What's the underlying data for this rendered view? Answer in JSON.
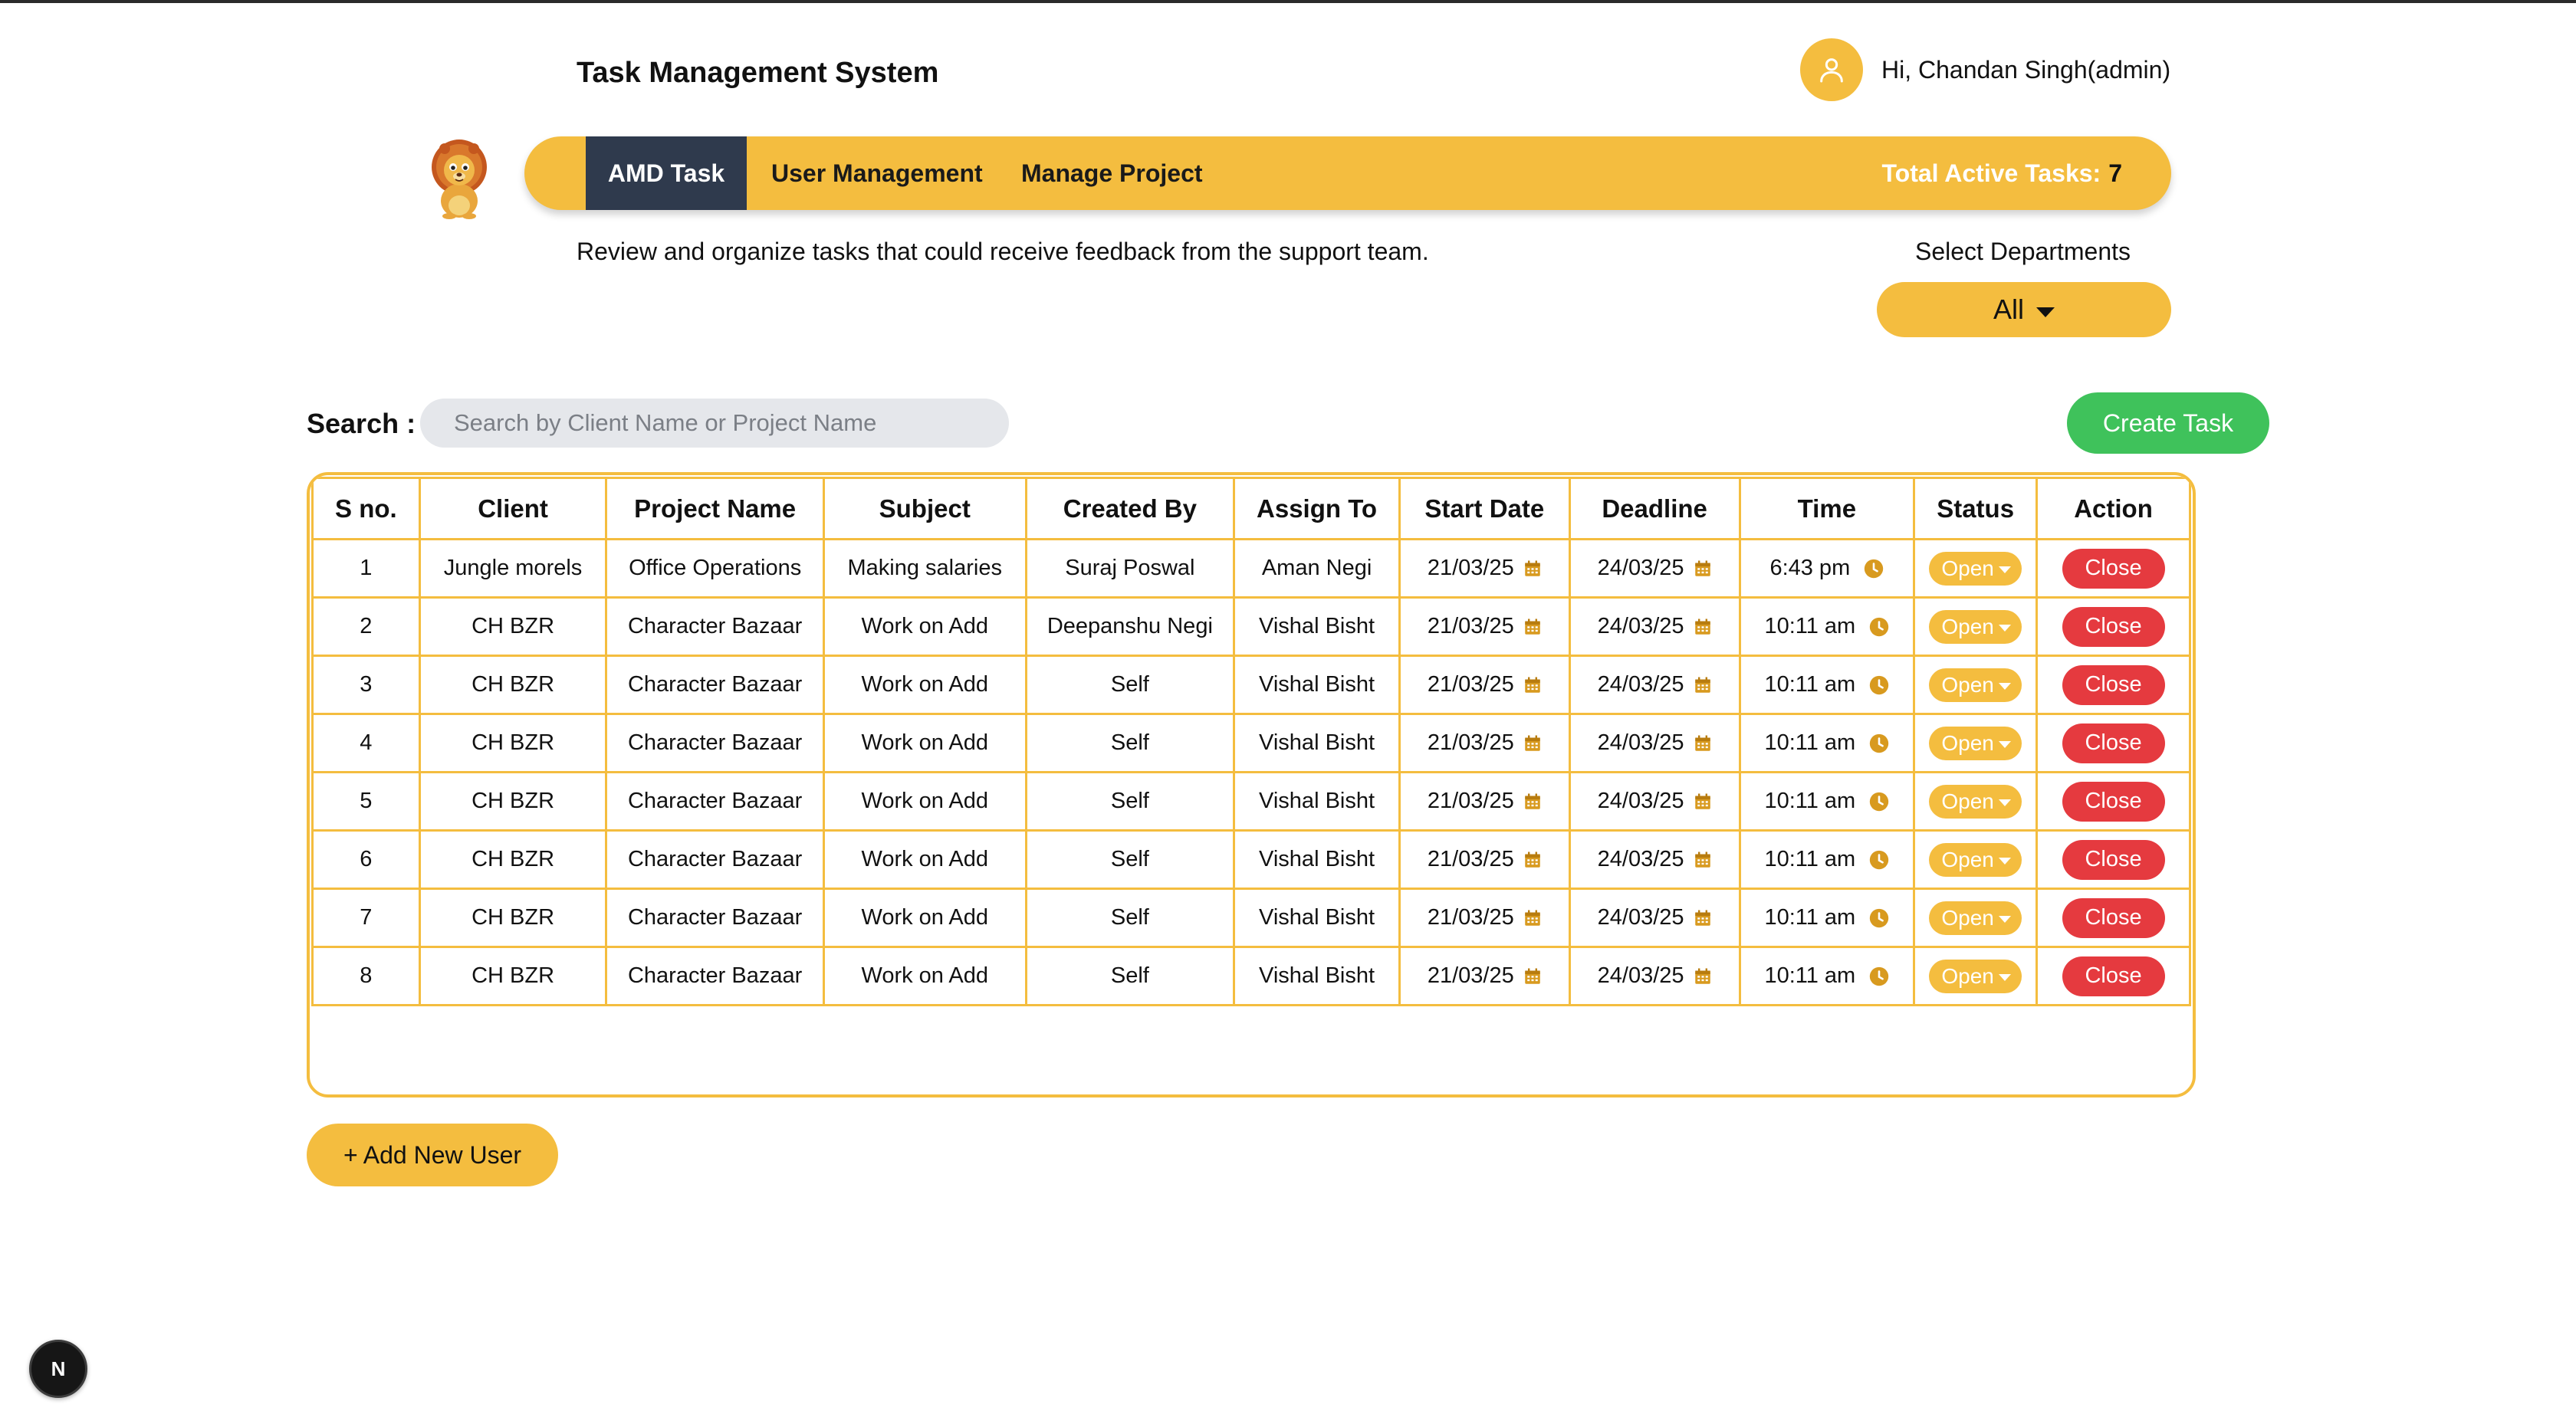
{
  "app": {
    "title": "Task Management System"
  },
  "user": {
    "greeting": "Hi, Chandan Singh(admin)",
    "avatar_icon": "user-icon"
  },
  "logo": {
    "icon": "lion-mascot-icon"
  },
  "nav": {
    "items": [
      {
        "label": "AMD Task",
        "active": true
      },
      {
        "label": "User Management",
        "active": false
      },
      {
        "label": "Manage Project",
        "active": false
      }
    ],
    "active_tasks_label": "Total Active Tasks:",
    "active_tasks_count": "7"
  },
  "subtitle": "Review and organize tasks that could receive feedback from the support team.",
  "departments": {
    "label": "Select Departments",
    "selected": "All"
  },
  "search": {
    "label": "Search :",
    "placeholder": "Search by Client Name or Project Name",
    "value": ""
  },
  "create_task_label": "Create Task",
  "table": {
    "headers": [
      "S no.",
      "Client",
      "Project Name",
      "Subject",
      "Created By",
      "Assign To",
      "Start Date",
      "Deadline",
      "Time",
      "Status",
      "Action"
    ],
    "rows": [
      {
        "sno": "1",
        "client": "Jungle morels",
        "project": "Office Operations",
        "subject": "Making salaries",
        "created_by": "Suraj Poswal",
        "assign_to": "Aman Negi",
        "start": "21/03/25",
        "deadline": "24/03/25",
        "time": "6:43 pm",
        "status": "Open",
        "action": "Close"
      },
      {
        "sno": "2",
        "client": "CH BZR",
        "project": "Character Bazaar",
        "subject": "Work on Add",
        "created_by": "Deepanshu Negi",
        "assign_to": "Vishal Bisht",
        "start": "21/03/25",
        "deadline": "24/03/25",
        "time": "10:11 am",
        "status": "Open",
        "action": "Close"
      },
      {
        "sno": "3",
        "client": "CH BZR",
        "project": "Character Bazaar",
        "subject": "Work on Add",
        "created_by": "Self",
        "assign_to": "Vishal Bisht",
        "start": "21/03/25",
        "deadline": "24/03/25",
        "time": "10:11 am",
        "status": "Open",
        "action": "Close"
      },
      {
        "sno": "4",
        "client": "CH BZR",
        "project": "Character Bazaar",
        "subject": "Work on Add",
        "created_by": "Self",
        "assign_to": "Vishal Bisht",
        "start": "21/03/25",
        "deadline": "24/03/25",
        "time": "10:11 am",
        "status": "Open",
        "action": "Close"
      },
      {
        "sno": "5",
        "client": "CH BZR",
        "project": "Character Bazaar",
        "subject": "Work on Add",
        "created_by": "Self",
        "assign_to": "Vishal Bisht",
        "start": "21/03/25",
        "deadline": "24/03/25",
        "time": "10:11 am",
        "status": "Open",
        "action": "Close"
      },
      {
        "sno": "6",
        "client": "CH BZR",
        "project": "Character Bazaar",
        "subject": "Work on Add",
        "created_by": "Self",
        "assign_to": "Vishal Bisht",
        "start": "21/03/25",
        "deadline": "24/03/25",
        "time": "10:11 am",
        "status": "Open",
        "action": "Close"
      },
      {
        "sno": "7",
        "client": "CH BZR",
        "project": "Character Bazaar",
        "subject": "Work on Add",
        "created_by": "Self",
        "assign_to": "Vishal Bisht",
        "start": "21/03/25",
        "deadline": "24/03/25",
        "time": "10:11 am",
        "status": "Open",
        "action": "Close"
      },
      {
        "sno": "8",
        "client": "CH BZR",
        "project": "Character Bazaar",
        "subject": "Work on Add",
        "created_by": "Self",
        "assign_to": "Vishal Bisht",
        "start": "21/03/25",
        "deadline": "24/03/25",
        "time": "10:11 am",
        "status": "Open",
        "action": "Close"
      }
    ]
  },
  "add_user_label": "+ Add New User",
  "dev_badge": {
    "letter": "N"
  },
  "colors": {
    "accent": "#f4bd3f",
    "nav_active": "#2f3a4d",
    "create": "#3fc25b",
    "close": "#e53a3f"
  }
}
